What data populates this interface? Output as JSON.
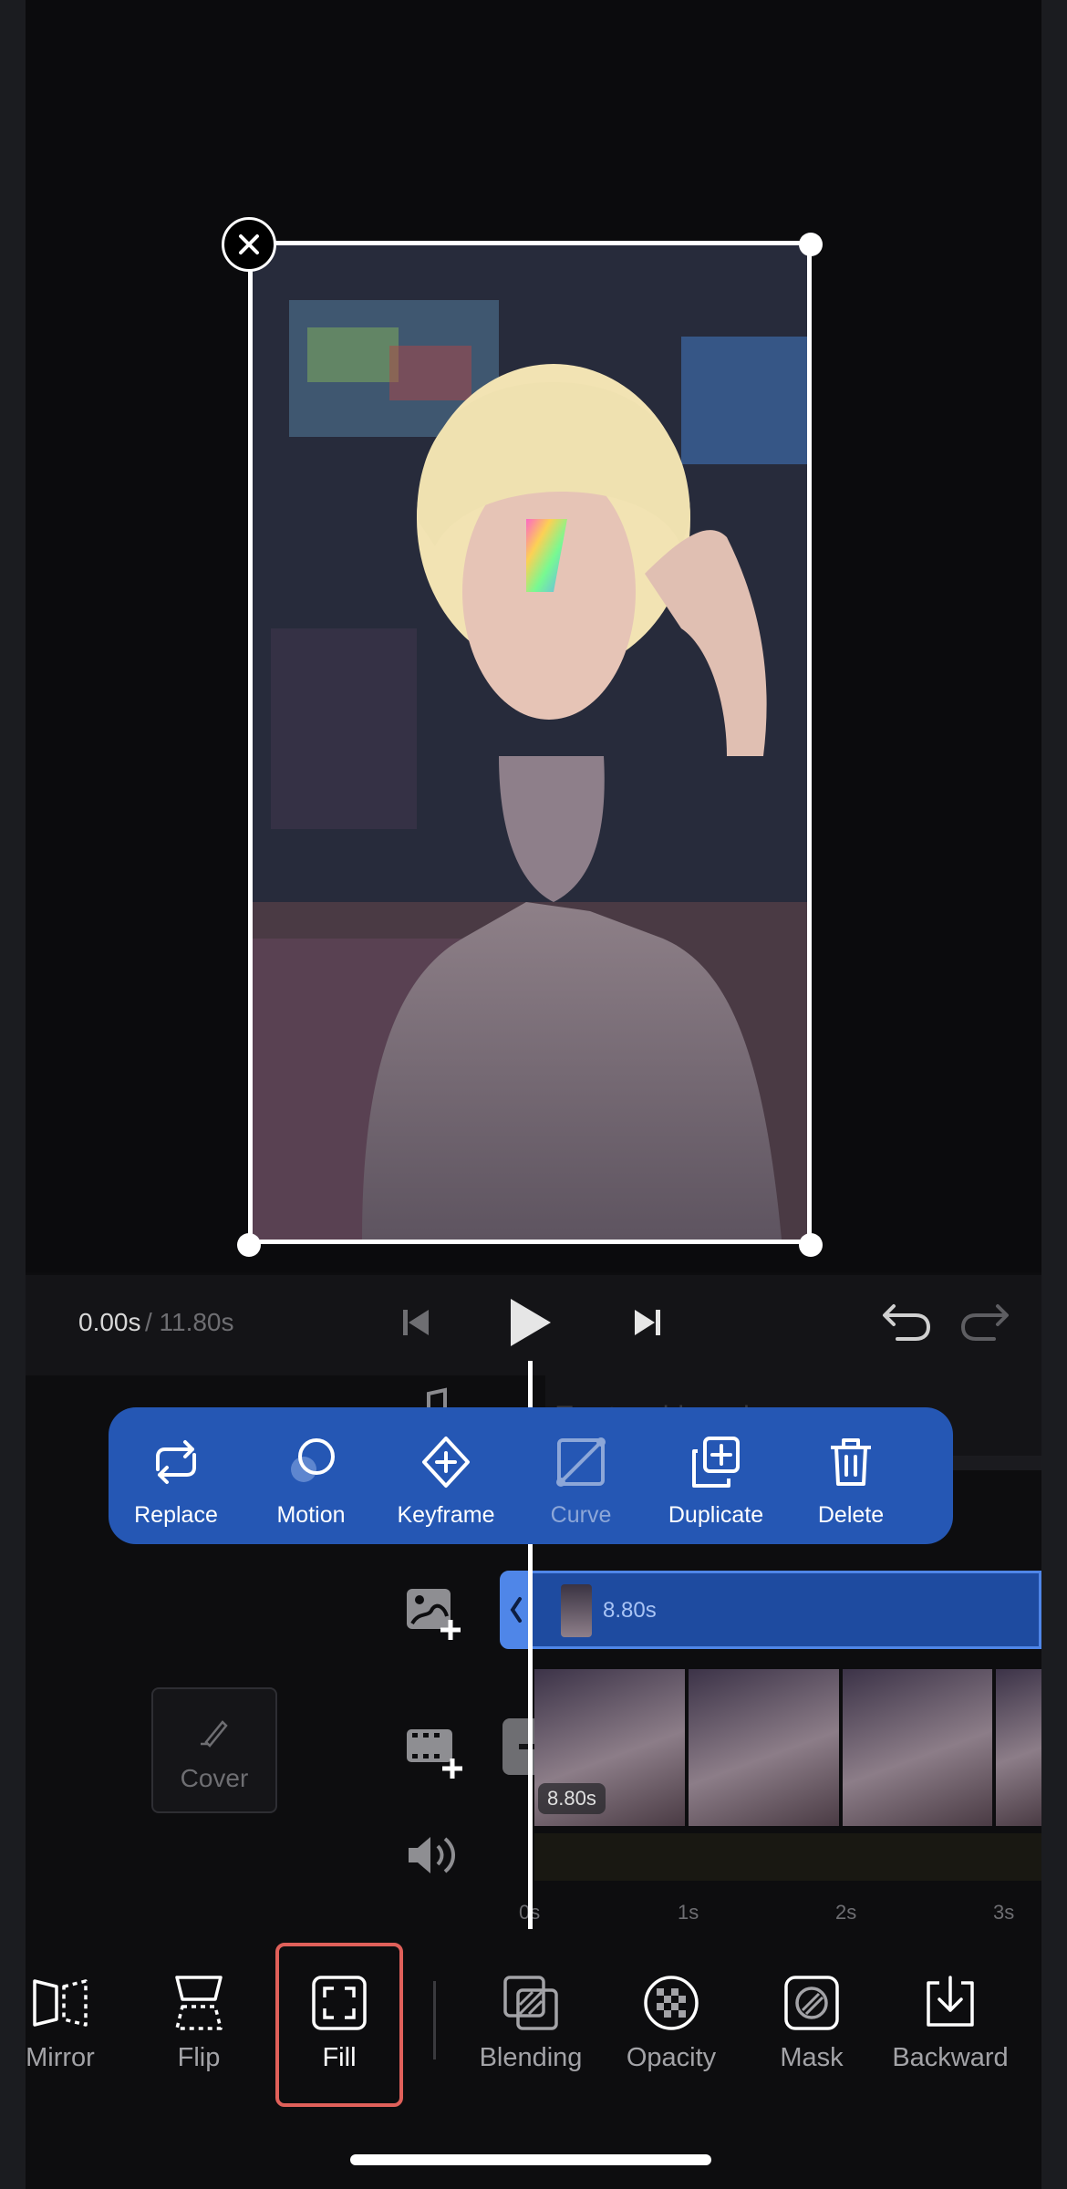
{
  "playback": {
    "current_time": "0.00s",
    "total_time": "/ 11.80s"
  },
  "audio_track": {
    "placeholder": "Tap to add music"
  },
  "clip_popup": {
    "items": [
      {
        "label": "Replace",
        "icon": "replace-icon"
      },
      {
        "label": "Motion",
        "icon": "motion-icon"
      },
      {
        "label": "Keyframe",
        "icon": "keyframe-icon"
      },
      {
        "label": "Curve",
        "icon": "curve-icon",
        "disabled": true
      },
      {
        "label": "Duplicate",
        "icon": "duplicate-icon"
      },
      {
        "label": "Delete",
        "icon": "delete-icon"
      }
    ]
  },
  "overlay_clip": {
    "duration": "8.80s"
  },
  "video_clip": {
    "duration": "8.80s"
  },
  "cover": {
    "label": "Cover"
  },
  "ruler": {
    "ticks": [
      "0s",
      "1s",
      "2s",
      "3s"
    ]
  },
  "toolbar": {
    "items": [
      {
        "label": "Mirror",
        "icon": "mirror-icon"
      },
      {
        "label": "Flip",
        "icon": "flip-icon"
      },
      {
        "label": "Fill",
        "icon": "fill-icon",
        "selected": true
      },
      {
        "label": "Blending",
        "icon": "blending-icon"
      },
      {
        "label": "Opacity",
        "icon": "opacity-icon"
      },
      {
        "label": "Mask",
        "icon": "mask-icon"
      },
      {
        "label": "Backward",
        "icon": "backward-icon"
      }
    ]
  },
  "colors": {
    "accent": "#2557b4",
    "overlay_clip": "#1e4ba0",
    "selection": "#e0605a",
    "background": "#0d0d0f"
  }
}
